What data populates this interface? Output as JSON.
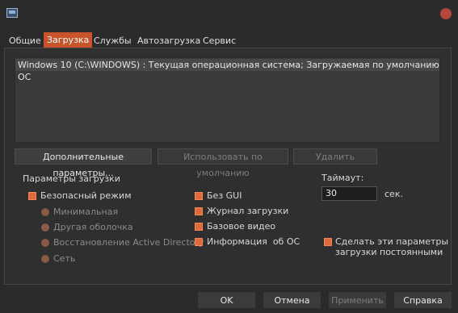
{
  "tabs": [
    {
      "label": "Общие"
    },
    {
      "label": "Загрузка"
    },
    {
      "label": "Службы"
    },
    {
      "label": "Автозагрузка"
    },
    {
      "label": "Сервис"
    }
  ],
  "active_tab": "Загрузка",
  "os_list": [
    "Windows 10 (C:\\WINDOWS) : Текущая операционная система; Загружаемая по умолчанию ОС"
  ],
  "buttons": {
    "advanced": "Дополнительные параметры...",
    "set_default": "Использовать по умолчанию",
    "delete": "Удалить"
  },
  "boot_options": {
    "title": "Параметры загрузки",
    "safe_mode": "Безопасный режим",
    "minimal": "Минимальная",
    "alternate_shell": "Другая оболочка",
    "ad_repair": "Восстановление Active Directory",
    "network": "Сеть",
    "no_gui": "Без GUI",
    "boot_log": "Журнал загрузки",
    "base_video": "Базовое видео",
    "os_info": "Информация  об ОС"
  },
  "timeout": {
    "label": "Таймаут:",
    "value": "30",
    "unit": "сек."
  },
  "make_permanent": {
    "line1": "Сделать эти параметры",
    "line2": "загрузки постоянными"
  },
  "footer": {
    "ok": "OK",
    "cancel": "Отмена",
    "apply": "Применить",
    "help": "Справка"
  },
  "colors": {
    "accent": "#c9542c",
    "checkbox": "#e06a3a",
    "background": "#2b2b2b"
  }
}
